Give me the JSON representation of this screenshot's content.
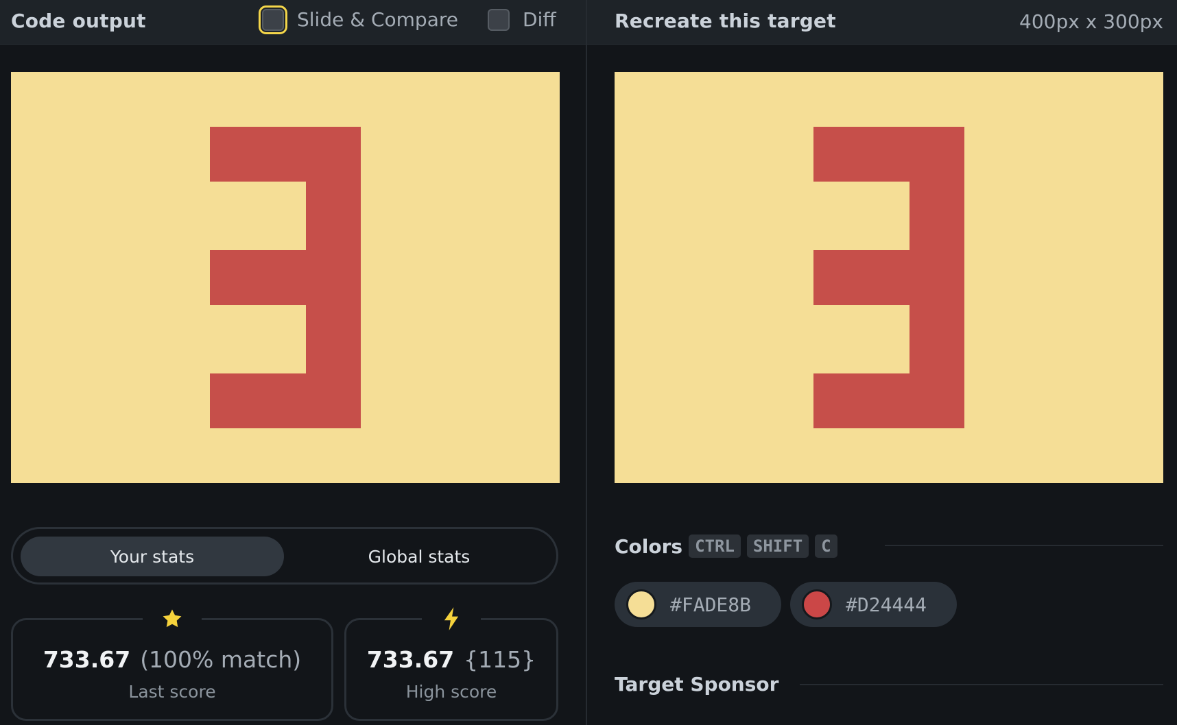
{
  "header_left": {
    "title": "Code output",
    "slide_compare_label": "Slide & Compare",
    "diff_label": "Diff"
  },
  "header_right": {
    "title": "Recreate this target",
    "dimensions": "400px x 300px"
  },
  "stats_tabs": {
    "your_stats": "Your stats",
    "global_stats": "Global stats",
    "active": "your_stats"
  },
  "last_score": {
    "value": "733.67",
    "detail": "(100% match)",
    "caption": "Last score",
    "icon": "star-icon"
  },
  "high_score": {
    "value": "733.67",
    "detail": "{115}",
    "caption": "High score",
    "icon": "bolt-icon"
  },
  "colors": {
    "title": "Colors",
    "shortcut": [
      "CTRL",
      "SHIFT",
      "C"
    ],
    "swatches": [
      {
        "code": "#FADE8B",
        "color": "#F5DE96"
      },
      {
        "code": "#D24444",
        "color": "#CB4747"
      }
    ]
  },
  "sponsor": {
    "title": "Target Sponsor"
  },
  "canvas_colors": {
    "background": "#F5DE96",
    "shape": "#C64F4A"
  }
}
